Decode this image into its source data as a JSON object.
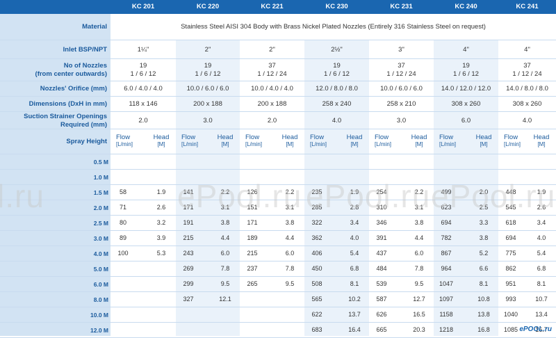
{
  "models": [
    "KC 201",
    "KC 220",
    "KC 221",
    "KC 230",
    "KC 231",
    "KC 240",
    "KC 241"
  ],
  "labels": {
    "material": "Material",
    "inlet": "Inlet BSP/NPT",
    "nozzles": "No of Nozzles\n(from center outwards)",
    "orifice": "Nozzles' Orifice (mm)",
    "dimensions": "Dimensions (DxH in mm)",
    "strainer": "Suction Strainer Openings\nRequired (mm)",
    "spray_height": "Spray Height"
  },
  "material_text": "Stainless Steel AISI 304 Body with Brass Nickel Plated Nozzles (Entirely 316 Stainless Steel on request)",
  "inlet": [
    "1¼\"",
    "2\"",
    "2\"",
    "2½\"",
    "3\"",
    "4\"",
    "4\""
  ],
  "nozzles_count": [
    "19",
    "19",
    "37",
    "19",
    "37",
    "19",
    "37"
  ],
  "nozzles_split": [
    "1 / 6 / 12",
    "1 / 6 / 12",
    "1 / 12 / 24",
    "1 / 6 / 12",
    "1 / 12 / 24",
    "1 / 6 / 12",
    "1 / 12 / 24"
  ],
  "orifice": [
    "6.0 / 4.0 / 4.0",
    "10.0 / 6.0 / 6.0",
    "10.0 / 4.0 / 4.0",
    "12.0 / 8.0 / 8.0",
    "10.0 / 6.0 / 6.0",
    "14.0 / 12.0 / 12.0",
    "14.0 / 8.0 / 8.0"
  ],
  "dimensions": [
    "118 x 146",
    "200 x 188",
    "200 x 188",
    "258 x 240",
    "258 x 210",
    "308 x 260",
    "308 x 260"
  ],
  "strainer": [
    "2.0",
    "3.0",
    "2.0",
    "4.0",
    "3.0",
    "6.0",
    "4.0"
  ],
  "sub_headers": {
    "flow": "Flow",
    "flow_unit": "[L/min]",
    "head": "Head",
    "head_unit": "[M]"
  },
  "heights": [
    "0.5 M",
    "1.0 M",
    "1.5 M",
    "2.0 M",
    "2.5 M",
    "3.0 M",
    "4.0 M",
    "5.0 M",
    "6.0 M",
    "8.0 M",
    "10.0 M",
    "12.0 M"
  ],
  "performance": [
    [
      [
        "",
        ""
      ],
      [
        "",
        ""
      ],
      [
        "",
        ""
      ],
      [
        "",
        ""
      ],
      [
        "",
        ""
      ],
      [
        "",
        ""
      ],
      [
        "",
        ""
      ]
    ],
    [
      [
        "",
        ""
      ],
      [
        "",
        ""
      ],
      [
        "",
        ""
      ],
      [
        "",
        ""
      ],
      [
        "",
        ""
      ],
      [
        "",
        ""
      ],
      [
        "",
        ""
      ]
    ],
    [
      [
        "58",
        "1.9"
      ],
      [
        "141",
        "2.2"
      ],
      [
        "126",
        "2.2"
      ],
      [
        "235",
        "1.9"
      ],
      [
        "254",
        "2.2"
      ],
      [
        "499",
        "2.0"
      ],
      [
        "448",
        "1.9"
      ]
    ],
    [
      [
        "71",
        "2.6"
      ],
      [
        "171",
        "3.1"
      ],
      [
        "151",
        "3.1"
      ],
      [
        "285",
        "2.8"
      ],
      [
        "310",
        "3.1"
      ],
      [
        "623",
        "2.5"
      ],
      [
        "545",
        "2.6"
      ]
    ],
    [
      [
        "80",
        "3.2"
      ],
      [
        "191",
        "3.8"
      ],
      [
        "171",
        "3.8"
      ],
      [
        "322",
        "3.4"
      ],
      [
        "346",
        "3.8"
      ],
      [
        "694",
        "3.3"
      ],
      [
        "618",
        "3.4"
      ]
    ],
    [
      [
        "89",
        "3.9"
      ],
      [
        "215",
        "4.4"
      ],
      [
        "189",
        "4.4"
      ],
      [
        "362",
        "4.0"
      ],
      [
        "391",
        "4.4"
      ],
      [
        "782",
        "3.8"
      ],
      [
        "694",
        "4.0"
      ]
    ],
    [
      [
        "100",
        "5.3"
      ],
      [
        "243",
        "6.0"
      ],
      [
        "215",
        "6.0"
      ],
      [
        "406",
        "5.4"
      ],
      [
        "437",
        "6.0"
      ],
      [
        "867",
        "5.2"
      ],
      [
        "775",
        "5.4"
      ]
    ],
    [
      [
        "",
        ""
      ],
      [
        "269",
        "7.8"
      ],
      [
        "237",
        "7.8"
      ],
      [
        "450",
        "6.8"
      ],
      [
        "484",
        "7.8"
      ],
      [
        "964",
        "6.6"
      ],
      [
        "862",
        "6.8"
      ]
    ],
    [
      [
        "",
        ""
      ],
      [
        "299",
        "9.5"
      ],
      [
        "265",
        "9.5"
      ],
      [
        "508",
        "8.1"
      ],
      [
        "539",
        "9.5"
      ],
      [
        "1047",
        "8.1"
      ],
      [
        "951",
        "8.1"
      ]
    ],
    [
      [
        "",
        ""
      ],
      [
        "327",
        "12.1"
      ],
      [
        "",
        ""
      ],
      [
        "565",
        "10.2"
      ],
      [
        "587",
        "12.7"
      ],
      [
        "1097",
        "10.8"
      ],
      [
        "993",
        "10.7"
      ]
    ],
    [
      [
        "",
        ""
      ],
      [
        "",
        ""
      ],
      [
        "",
        ""
      ],
      [
        "622",
        "13.7"
      ],
      [
        "626",
        "16.5"
      ],
      [
        "1158",
        "13.8"
      ],
      [
        "1040",
        "13.4"
      ]
    ],
    [
      [
        "",
        ""
      ],
      [
        "",
        ""
      ],
      [
        "",
        ""
      ],
      [
        "683",
        "16.4"
      ],
      [
        "665",
        "20.3"
      ],
      [
        "1218",
        "16.8"
      ],
      [
        "1085",
        "16.7"
      ]
    ]
  ],
  "watermarks": [
    "l.ru",
    "ePool.ru",
    "ePool.ru",
    "ePool.ru"
  ],
  "logo": "ePOOL.ru"
}
